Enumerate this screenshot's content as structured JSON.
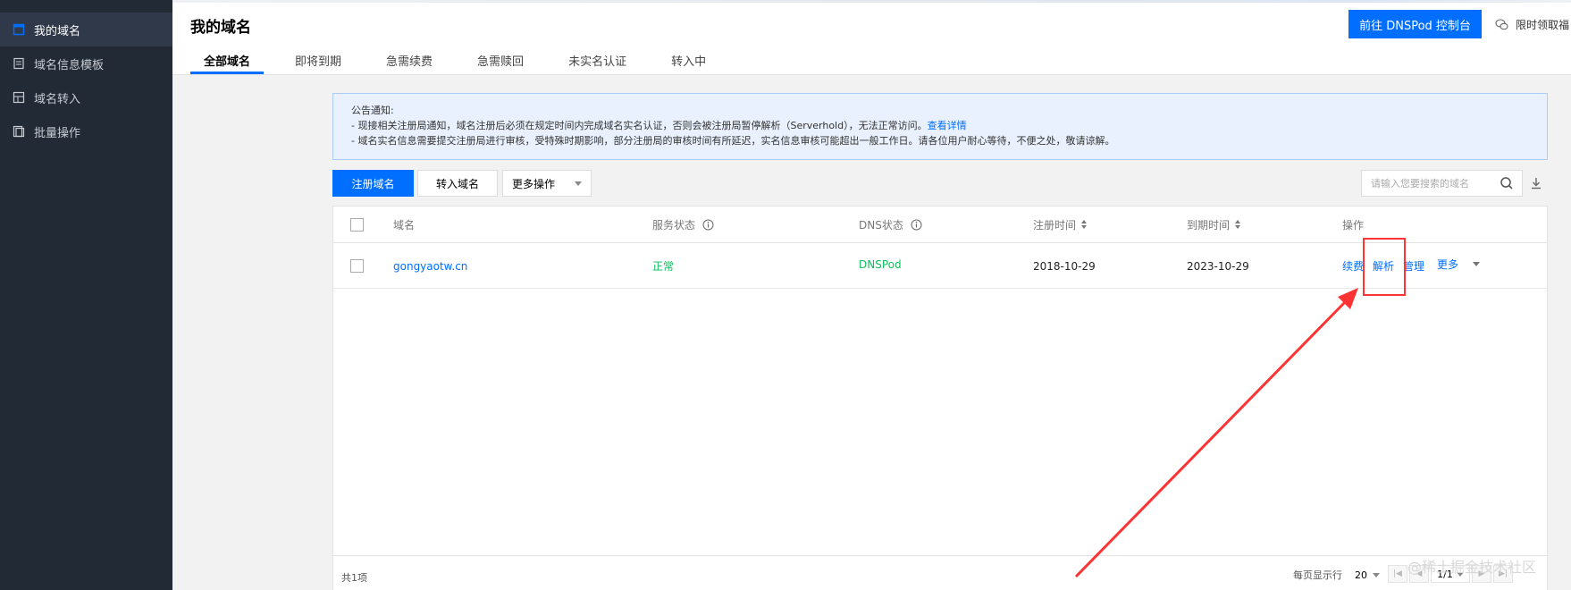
{
  "sidebar": {
    "items": [
      {
        "label": "我的域名",
        "icon": "domain-icon",
        "active": true
      },
      {
        "label": "域名信息模板",
        "icon": "document-icon",
        "active": false
      },
      {
        "label": "域名转入",
        "icon": "transfer-icon",
        "active": false
      },
      {
        "label": "批量操作",
        "icon": "batch-icon",
        "active": false
      }
    ]
  },
  "header": {
    "title": "我的域名",
    "tabs": [
      "全部域名",
      "即将到期",
      "急需续费",
      "急需赎回",
      "未实名认证",
      "转入中"
    ],
    "active_tab": "全部域名",
    "dnspod_button": "前往 DNSPod 控制台",
    "promo_text": "限时领取福"
  },
  "notice": {
    "title": "公告通知:",
    "line1": "- 现接相关注册局通知，域名注册后必须在规定时间内完成域名实名认证，否则会被注册局暂停解析（Serverhold），无法正常访问。",
    "line1_link": "查看详情",
    "line2": "- 域名实名信息需要提交注册局进行审核，受特殊时期影响，部分注册局的审核时间有所延迟，实名信息审核可能超出一般工作日。请各位用户耐心等待，不便之处，敬请谅解。"
  },
  "toolbar": {
    "register_label": "注册域名",
    "transfer_label": "转入域名",
    "more_label": "更多操作",
    "search_placeholder": "请输入您要搜索的域名"
  },
  "table": {
    "headers": {
      "domain": "域名",
      "service_status": "服务状态",
      "dns_status": "DNS状态",
      "reg_time": "注册时间",
      "exp_time": "到期时间",
      "ops": "操作"
    },
    "rows": [
      {
        "domain": "gongyaotw.cn",
        "service_status": "正常",
        "dns_status": "DNSPod",
        "reg_time": "2018-10-29",
        "exp_time": "2023-10-29",
        "ops": {
          "renew": "续费",
          "resolve": "解析",
          "manage": "管理",
          "more": "更多"
        }
      }
    ]
  },
  "footer": {
    "total": "共1项",
    "per_page_label": "每页显示行",
    "per_page_value": "20",
    "page": "1/1"
  },
  "watermark": "@稀土掘金技术社区",
  "colors": {
    "primary": "#006eff",
    "sidebar_bg": "#222a36",
    "status_ok": "#0abf5b",
    "annotation": "#ff3333"
  }
}
